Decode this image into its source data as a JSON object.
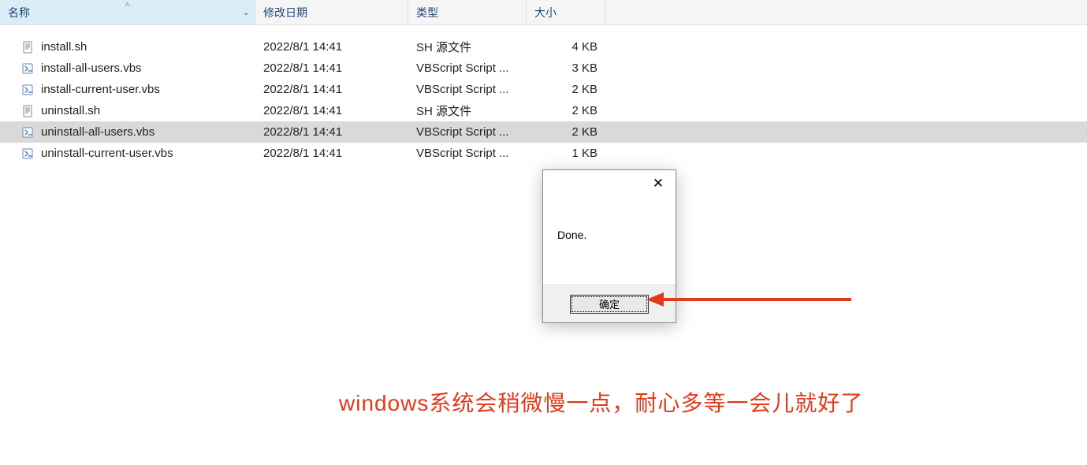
{
  "columns": {
    "name": "名称",
    "date": "修改日期",
    "type": "类型",
    "size": "大小"
  },
  "files": [
    {
      "name": "install.sh",
      "date": "2022/8/1 14:41",
      "type": "SH 源文件",
      "size": "4 KB",
      "icon": "sh",
      "selected": false
    },
    {
      "name": "install-all-users.vbs",
      "date": "2022/8/1 14:41",
      "type": "VBScript Script ...",
      "size": "3 KB",
      "icon": "vbs",
      "selected": false
    },
    {
      "name": "install-current-user.vbs",
      "date": "2022/8/1 14:41",
      "type": "VBScript Script ...",
      "size": "2 KB",
      "icon": "vbs",
      "selected": false
    },
    {
      "name": "uninstall.sh",
      "date": "2022/8/1 14:41",
      "type": "SH 源文件",
      "size": "2 KB",
      "icon": "sh",
      "selected": false
    },
    {
      "name": "uninstall-all-users.vbs",
      "date": "2022/8/1 14:41",
      "type": "VBScript Script ...",
      "size": "2 KB",
      "icon": "vbs",
      "selected": true
    },
    {
      "name": "uninstall-current-user.vbs",
      "date": "2022/8/1 14:41",
      "type": "VBScript Script ...",
      "size": "1 KB",
      "icon": "vbs",
      "selected": false
    }
  ],
  "dialog": {
    "message": "Done.",
    "ok_label": "确定"
  },
  "annotation": "windows系统会稍微慢一点，耐心多等一会儿就好了"
}
